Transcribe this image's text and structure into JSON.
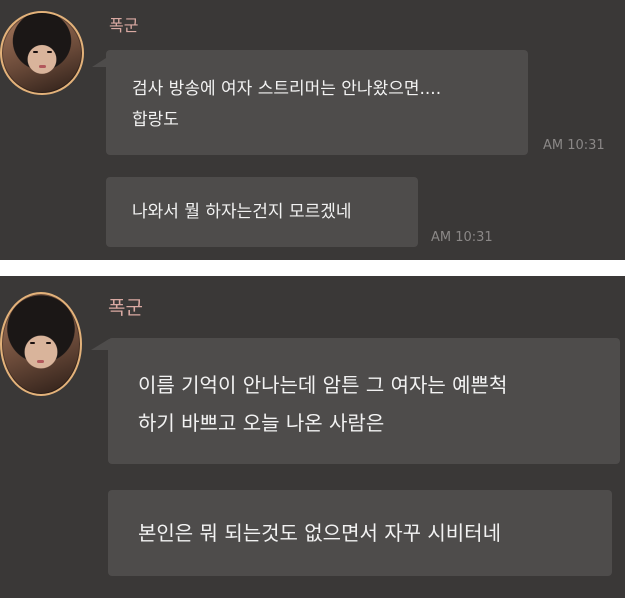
{
  "top_panel": {
    "sender_name": "폭군",
    "messages": [
      {
        "lines": [
          "검사 방송에 여자 스트리머는 안나왔으면....",
          "합랑도"
        ],
        "time": "AM 10:31"
      },
      {
        "lines": [
          "나와서 뭘 하자는건지 모르겠네"
        ],
        "time": "AM 10:31"
      }
    ]
  },
  "bottom_panel": {
    "sender_name": "폭군",
    "messages": [
      {
        "lines": [
          "이름 기억이 안나는데 암튼 그 여자는 예쁜척",
          "하기 바쁘고 오늘 나온 사람은"
        ]
      },
      {
        "lines": [
          "본인은 뭐 되는것도 없으면서 자꾸 시비터네"
        ]
      }
    ]
  },
  "colors": {
    "background": "#3a3837",
    "bubble": "#4e4c4b",
    "name": "#d9a9a2",
    "text": "#f2f2f2",
    "timestamp": "#8a8786",
    "avatar_ring": "#e3b27a"
  }
}
